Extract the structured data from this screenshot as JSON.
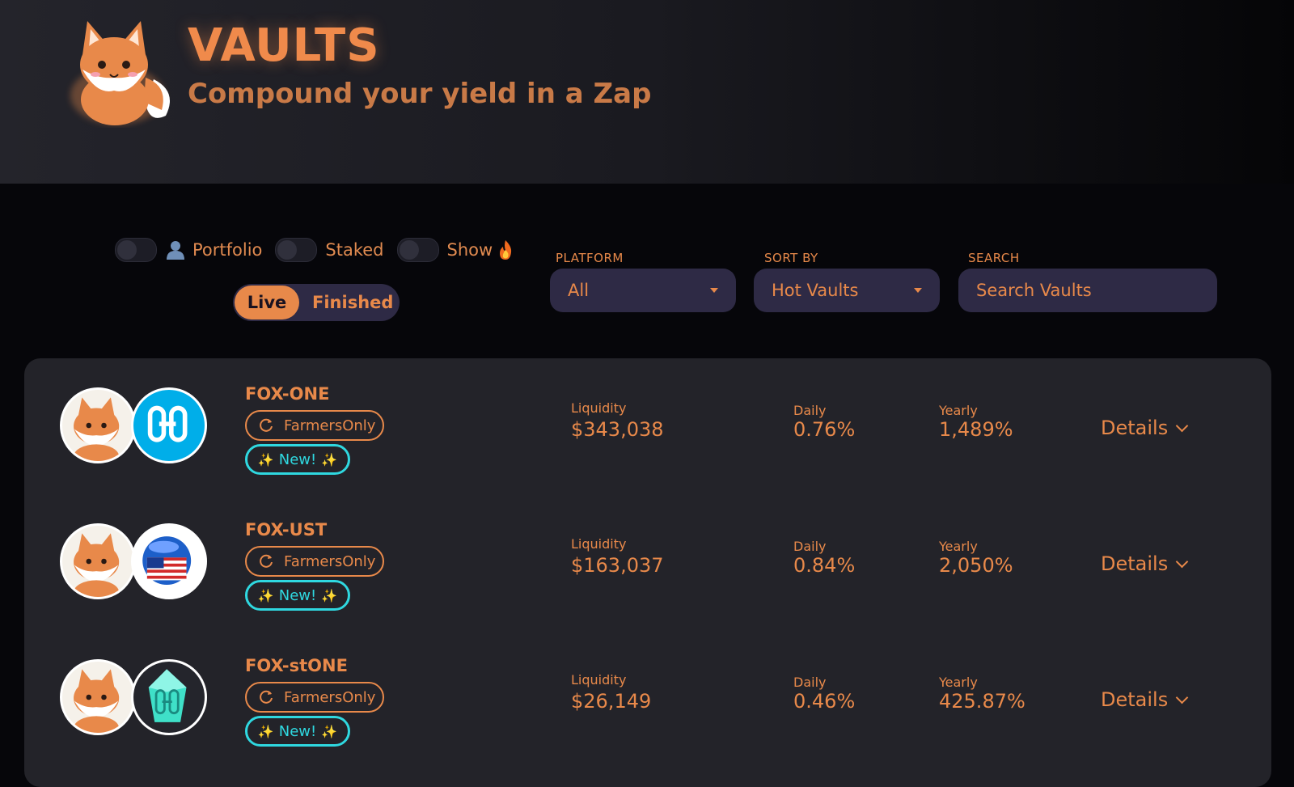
{
  "header": {
    "title": "VAULTS",
    "subtitle": "Compound your yield in a Zap"
  },
  "toggles": [
    {
      "label": "Portfolio",
      "icon": "user-icon",
      "on": false
    },
    {
      "label": "Staked",
      "on": false
    },
    {
      "label": "Show",
      "icon": "flame-icon",
      "on": false
    }
  ],
  "status_toggle": {
    "live": "Live",
    "finished": "Finished",
    "selected": "Live"
  },
  "filters": {
    "platform_label": "PLATFORM",
    "platform_value": "All",
    "sort_label": "SORT BY",
    "sort_value": "Hot Vaults",
    "search_label": "SEARCH",
    "search_placeholder": "Search Vaults"
  },
  "vaults": [
    {
      "name": "FOX-ONE",
      "platform": "FarmersOnly",
      "badge": "New!",
      "liquidity_label": "Liquidity",
      "liquidity": "$343,038",
      "daily_label": "Daily",
      "daily": "0.76%",
      "yearly_label": "Yearly",
      "yearly": "1,489%",
      "details": "Details",
      "token_icon": "harmony-one-icon"
    },
    {
      "name": "FOX-UST",
      "platform": "FarmersOnly",
      "badge": "New!",
      "liquidity_label": "Liquidity",
      "liquidity": "$163,037",
      "daily_label": "Daily",
      "daily": "0.84%",
      "yearly_label": "Yearly",
      "yearly": "2,050%",
      "details": "Details",
      "token_icon": "ust-icon"
    },
    {
      "name": "FOX-stONE",
      "platform": "FarmersOnly",
      "badge": "New!",
      "liquidity_label": "Liquidity",
      "liquidity": "$26,149",
      "daily_label": "Daily",
      "daily": "0.46%",
      "yearly_label": "Yearly",
      "yearly": "425.87%",
      "details": "Details",
      "token_icon": "stone-icon"
    }
  ],
  "colors": {
    "accent": "#e8894a",
    "new_badge": "#2fd8e0",
    "panel": "#232329",
    "control_bg": "#2e2a45"
  }
}
